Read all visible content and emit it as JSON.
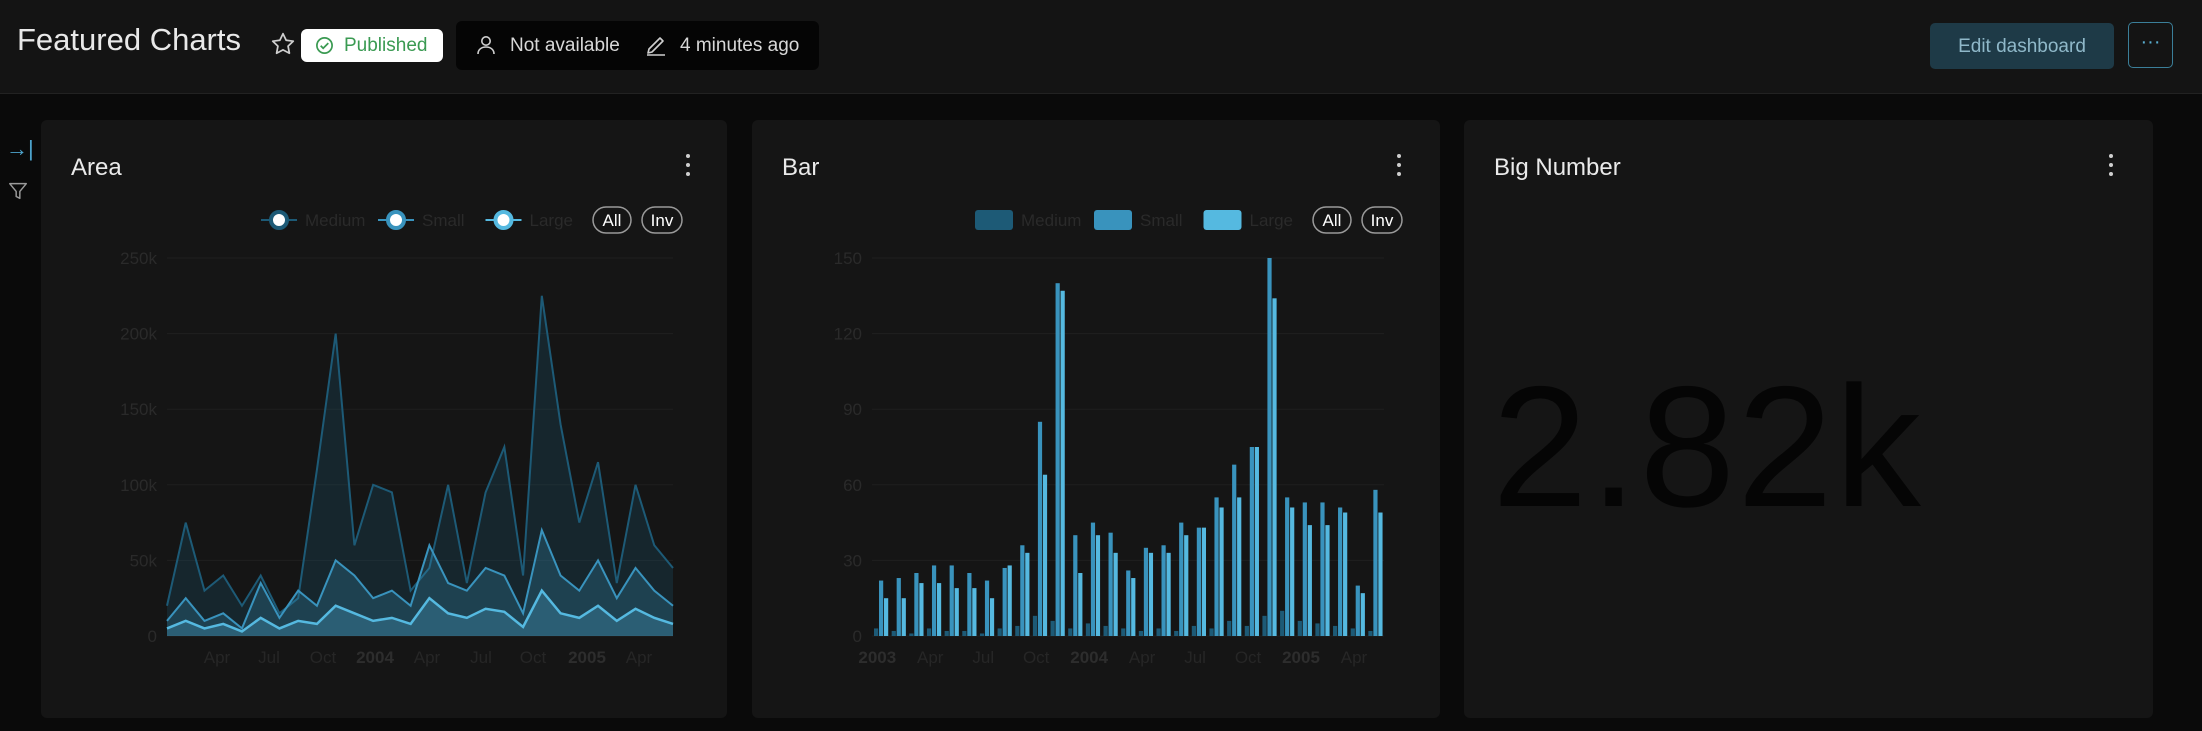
{
  "header": {
    "title": "Featured Charts",
    "status": "Published",
    "owner": "Not available",
    "modified": "4 minutes ago",
    "edit_label": "Edit dashboard",
    "more_label": "···"
  },
  "sidebar": {
    "collapse_icon": "→|",
    "filter_icon": "filter-icon"
  },
  "colors": {
    "medium": "#1d5a76",
    "small": "#3993bd",
    "large": "#55b9e0",
    "accent": "#4da3cc"
  },
  "cards": [
    {
      "title": "Area"
    },
    {
      "title": "Bar"
    },
    {
      "title": "Big Number"
    }
  ],
  "legend": {
    "medium": "Medium",
    "small": "Small",
    "large": "Large",
    "all": "All",
    "inv": "Inv"
  },
  "big_number": {
    "value": "2.82k"
  },
  "chart_data": [
    {
      "type": "area",
      "title": "",
      "x": [
        "2003-02",
        "2003-03",
        "2003-04",
        "2003-05",
        "2003-06",
        "2003-07",
        "2003-08",
        "2003-09",
        "2003-10",
        "2003-11",
        "2003-12",
        "2004-01",
        "2004-02",
        "2004-03",
        "2004-04",
        "2004-05",
        "2004-06",
        "2004-07",
        "2004-08",
        "2004-09",
        "2004-10",
        "2004-11",
        "2004-12",
        "2005-01",
        "2005-02",
        "2005-03",
        "2005-04",
        "2005-05"
      ],
      "series": [
        {
          "name": "Medium",
          "values": [
            20000,
            75000,
            30000,
            40000,
            20000,
            40000,
            15000,
            25000,
            110000,
            200000,
            60000,
            100000,
            95000,
            30000,
            45000,
            100000,
            35000,
            95000,
            125000,
            40000,
            225000,
            140000,
            75000,
            115000,
            35000,
            100000,
            60000,
            45000
          ]
        },
        {
          "name": "Small",
          "values": [
            10000,
            25000,
            10000,
            15000,
            5000,
            35000,
            12000,
            30000,
            20000,
            50000,
            40000,
            25000,
            30000,
            20000,
            60000,
            35000,
            30000,
            45000,
            40000,
            15000,
            70000,
            40000,
            30000,
            50000,
            25000,
            45000,
            30000,
            20000
          ]
        },
        {
          "name": "Large",
          "values": [
            5000,
            10000,
            5000,
            8000,
            3000,
            12000,
            5000,
            10000,
            8000,
            20000,
            15000,
            10000,
            12000,
            8000,
            25000,
            15000,
            12000,
            18000,
            16000,
            6000,
            30000,
            15000,
            12000,
            20000,
            10000,
            18000,
            12000,
            8000
          ]
        }
      ],
      "x_ticks": [
        "Apr",
        "Jul",
        "Oct",
        "2004",
        "Apr",
        "Jul",
        "Oct",
        "2005",
        "Apr"
      ],
      "y_ticks": [
        "0",
        "50k",
        "100k",
        "150k",
        "200k",
        "250k"
      ],
      "ylim": [
        0,
        250000
      ],
      "legend_position": "top-right"
    },
    {
      "type": "bar",
      "title": "",
      "categories": [
        "2003-01",
        "2003-02",
        "2003-03",
        "2003-04",
        "2003-05",
        "2003-06",
        "2003-07",
        "2003-08",
        "2003-09",
        "2003-10",
        "2003-11",
        "2003-12",
        "2004-01",
        "2004-02",
        "2004-03",
        "2004-04",
        "2004-05",
        "2004-06",
        "2004-07",
        "2004-08",
        "2004-09",
        "2004-10",
        "2004-11",
        "2004-12",
        "2005-01",
        "2005-02",
        "2005-03",
        "2005-04",
        "2005-05"
      ],
      "series": [
        {
          "name": "Medium",
          "values": [
            3,
            2,
            1,
            3,
            2,
            2,
            1,
            3,
            4,
            8,
            6,
            3,
            5,
            4,
            3,
            2,
            3,
            2,
            4,
            3,
            6,
            4,
            8,
            10,
            6,
            5,
            4,
            3,
            2
          ]
        },
        {
          "name": "Small",
          "values": [
            22,
            23,
            25,
            28,
            28,
            25,
            22,
            27,
            36,
            85,
            140,
            40,
            45,
            41,
            26,
            35,
            36,
            45,
            43,
            55,
            68,
            75,
            150,
            55,
            53,
            53,
            51,
            20,
            58
          ]
        },
        {
          "name": "Large",
          "values": [
            15,
            15,
            21,
            21,
            19,
            19,
            15,
            28,
            33,
            64,
            137,
            25,
            40,
            33,
            23,
            33,
            33,
            40,
            43,
            51,
            55,
            75,
            134,
            51,
            44,
            44,
            49,
            17,
            49
          ]
        }
      ],
      "x_ticks": [
        "2003",
        "Apr",
        "Jul",
        "Oct",
        "2004",
        "Apr",
        "Jul",
        "Oct",
        "2005",
        "Apr"
      ],
      "y_ticks": [
        "0",
        "30",
        "60",
        "90",
        "120",
        "150"
      ],
      "ylim": [
        0,
        150
      ],
      "legend_position": "top-right"
    }
  ]
}
